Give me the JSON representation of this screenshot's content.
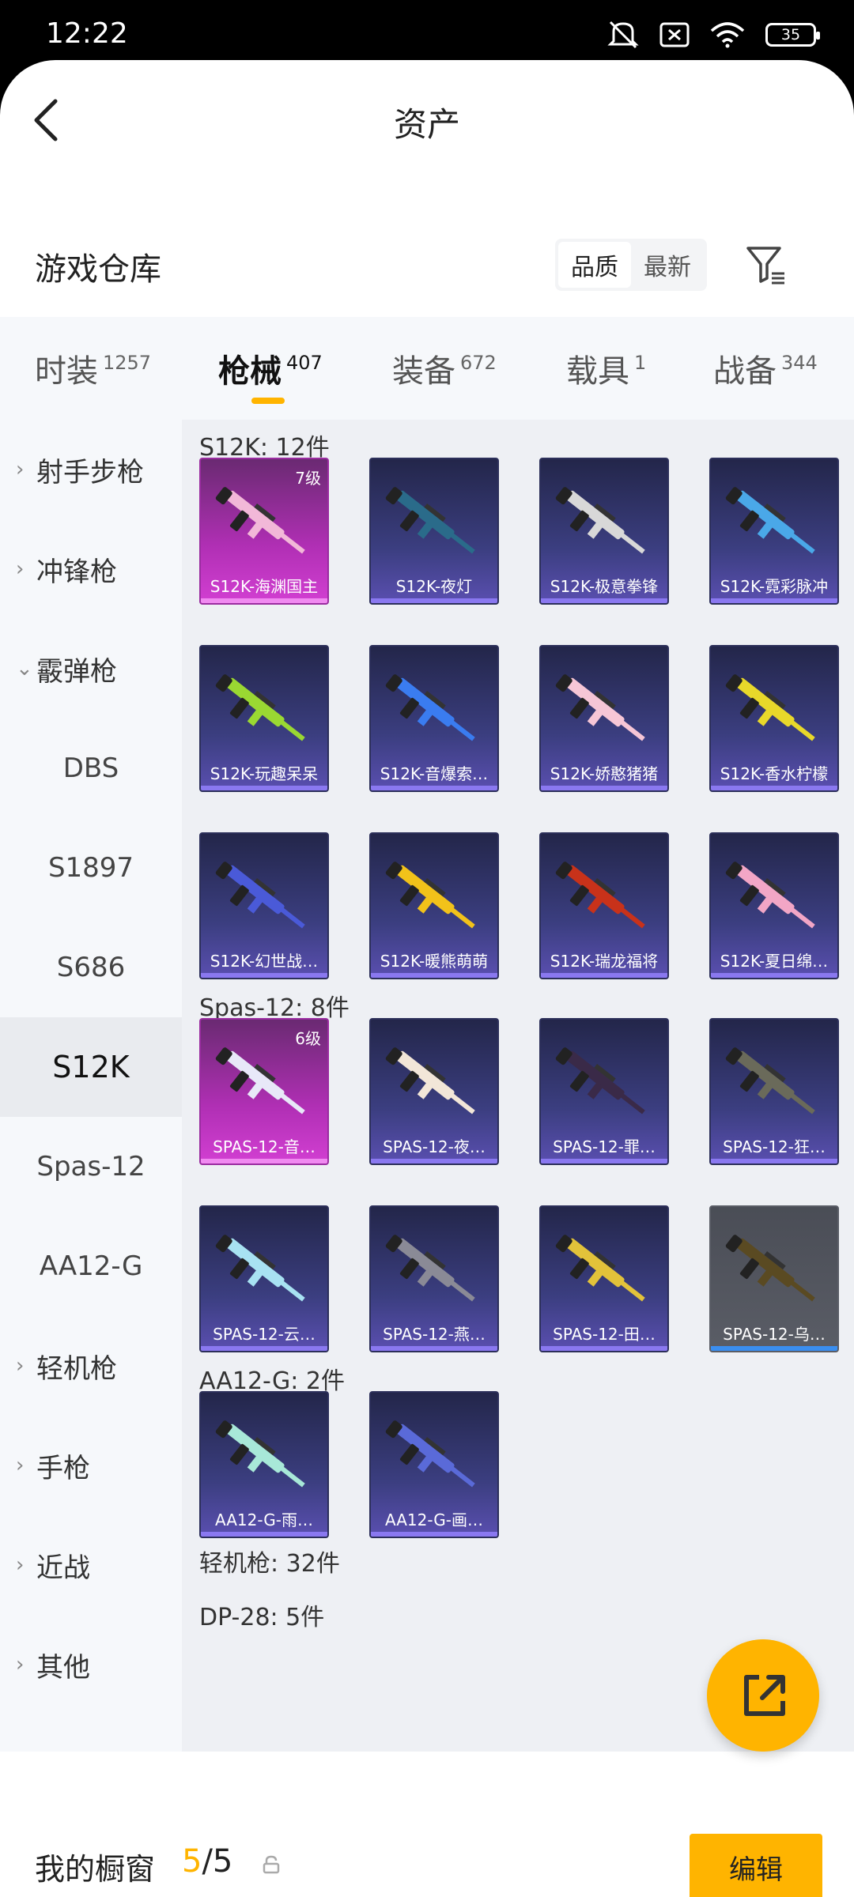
{
  "status": {
    "time": "12:22",
    "battery": "35"
  },
  "header": {
    "title": "资产",
    "back_icon": "chevron-left-icon"
  },
  "warehouse": {
    "title": "游戏仓库",
    "sort": [
      "品质",
      "最新"
    ],
    "sort_selected": "品质",
    "filter_icon": "filter-icon"
  },
  "tabs": [
    {
      "label": "时装",
      "count": "1257"
    },
    {
      "label": "枪械",
      "count": "407",
      "active": true
    },
    {
      "label": "装备",
      "count": "672"
    },
    {
      "label": "载具",
      "count": "1"
    },
    {
      "label": "战备",
      "count": "344"
    }
  ],
  "sidebar": [
    {
      "label": "射手步枪",
      "type": "group"
    },
    {
      "label": "冲锋枪",
      "type": "group"
    },
    {
      "label": "霰弹枪",
      "type": "group",
      "expanded": true
    },
    {
      "label": "DBS",
      "type": "sub"
    },
    {
      "label": "S1897",
      "type": "sub"
    },
    {
      "label": "S686",
      "type": "sub"
    },
    {
      "label": "S12K",
      "type": "sub",
      "selected": true
    },
    {
      "label": "Spas-12",
      "type": "sub"
    },
    {
      "label": "AA12-G",
      "type": "sub"
    },
    {
      "label": "轻机枪",
      "type": "group"
    },
    {
      "label": "手枪",
      "type": "group"
    },
    {
      "label": "近战",
      "type": "group"
    },
    {
      "label": "其他",
      "type": "group"
    }
  ],
  "sections": [
    {
      "title": "S12K: 12件",
      "items": [
        {
          "name": "S12K-海渊国主",
          "level": "7级",
          "rarity": "pink"
        },
        {
          "name": "S12K-夜灯"
        },
        {
          "name": "S12K-极意拳锋"
        },
        {
          "name": "S12K-霓彩脉冲"
        },
        {
          "name": "S12K-玩趣呆呆"
        },
        {
          "name": "S12K-音爆索…"
        },
        {
          "name": "S12K-娇憨猪猪"
        },
        {
          "name": "S12K-香水柠檬"
        },
        {
          "name": "S12K-幻世战…"
        },
        {
          "name": "S12K-暖熊萌萌"
        },
        {
          "name": "S12K-瑞龙福将"
        },
        {
          "name": "S12K-夏日绵…"
        }
      ]
    },
    {
      "title": "Spas-12: 8件",
      "items": [
        {
          "name": "SPAS-12-音…",
          "level": "6级",
          "rarity": "pink"
        },
        {
          "name": "SPAS-12-夜…"
        },
        {
          "name": "SPAS-12-罪…"
        },
        {
          "name": "SPAS-12-狂…"
        },
        {
          "name": "SPAS-12-云…"
        },
        {
          "name": "SPAS-12-燕…"
        },
        {
          "name": "SPAS-12-田…"
        },
        {
          "name": "SPAS-12-乌…",
          "rarity": "gray"
        }
      ]
    },
    {
      "title": "AA12-G: 2件",
      "items": [
        {
          "name": "AA12-G-雨…"
        },
        {
          "name": "AA12-G-画…"
        }
      ]
    },
    {
      "title": "轻机枪: 32件",
      "items": []
    },
    {
      "title": "DP-28: 5件",
      "items": []
    }
  ],
  "gun_colors": [
    "#f2b8d8",
    "#2a6b8a",
    "#d8d8d8",
    "#4aa8e8",
    "#9ad832",
    "#3a7cf0",
    "#f6c6d6",
    "#e8d82a",
    "#4a5ad8",
    "#f2c21a",
    "#c8321a",
    "#f2a6c6",
    "#e8e8f8",
    "#f2e6d8",
    "#3a2a48",
    "#6a6a5a",
    "#a8e2f2",
    "#8a8a96",
    "#e2c23a",
    "#5a4a22",
    "#a8e8d8",
    "#5a6ad8"
  ],
  "showcase": {
    "label": "我的橱窗",
    "current": "5",
    "total": "/5",
    "edit_label": "编辑"
  },
  "fab_icon": "share-out-icon"
}
